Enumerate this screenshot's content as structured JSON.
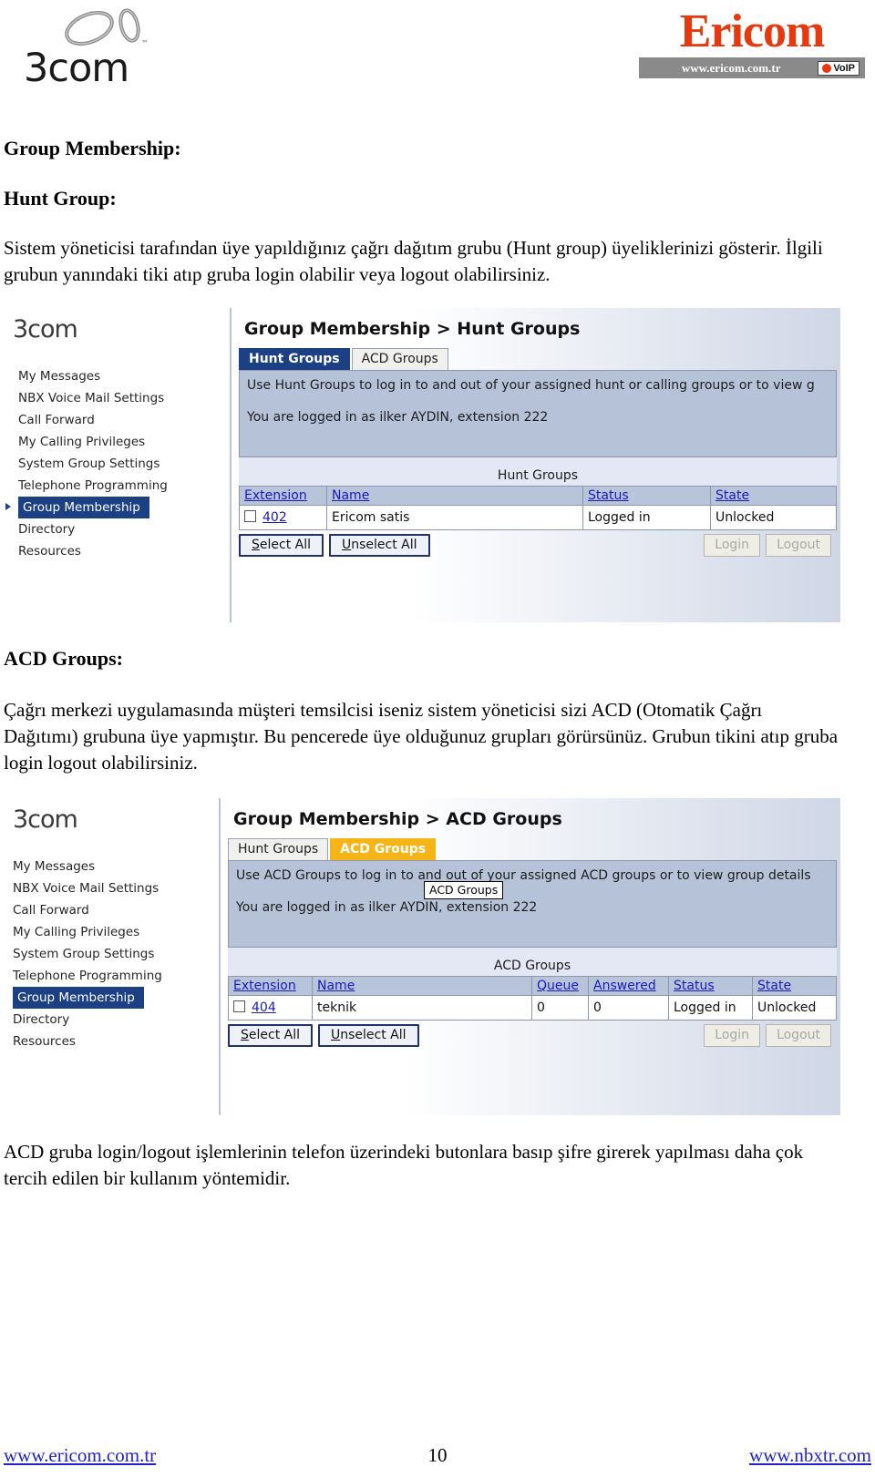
{
  "header": {
    "left_logo": "3com",
    "left_logo_tm": "™",
    "brand": {
      "name": "Ericom",
      "url": "www.ericom.com.tr",
      "badge": "VoIP"
    }
  },
  "document": {
    "heading_1": "Group Membership:",
    "heading_2": "Hunt Group:",
    "paragraph_1": "Sistem yöneticisi tarafından üye yapıldığınız çağrı dağıtım grubu (Hunt group) üyeliklerinizi gösterir. İlgili grubun yanındaki tiki atıp gruba login olabilir veya logout olabilirsiniz.",
    "heading_3": "ACD Groups:",
    "paragraph_2": "Çağrı merkezi uygulamasında müşteri temsilcisi iseniz sistem yöneticisi sizi ACD (Otomatik Çağrı Dağıtımı) grubuna üye yapmıştır. Bu pencerede üye olduğunuz grupları görürsünüz. Grubun tikini atıp gruba login logout olabilirsiniz.",
    "paragraph_3": "ACD gruba login/logout işlemlerinin telefon üzerindeki butonlara basıp şifre girerek yapılması daha çok tercih edilen bir kullanım yöntemidir."
  },
  "sidebar": {
    "logo": "3com",
    "items": [
      {
        "label": "My Messages",
        "active": false
      },
      {
        "label": "NBX Voice Mail Settings",
        "active": false
      },
      {
        "label": "Call Forward",
        "active": false
      },
      {
        "label": "My Calling Privileges",
        "active": false
      },
      {
        "label": "System Group Settings",
        "active": false
      },
      {
        "label": "Telephone Programming",
        "active": false
      },
      {
        "label": "Group Membership",
        "active": true
      },
      {
        "label": "Directory",
        "active": false
      },
      {
        "label": "Resources",
        "active": false
      }
    ]
  },
  "screenshot_hunt": {
    "title": "Group Membership > Hunt Groups",
    "tabs": [
      {
        "label": "Hunt Groups",
        "state": "active-blue"
      },
      {
        "label": "ACD Groups",
        "state": "inactive"
      }
    ],
    "info_line_1": "Use Hunt Groups to log in to and out of your assigned hunt or calling groups or to view g",
    "info_line_2": "You are logged in as ilker AYDIN, extension 222",
    "table_caption": "Hunt Groups",
    "columns": [
      "Extension",
      "Name",
      "Status",
      "State"
    ],
    "rows": [
      {
        "extension": "402",
        "name": "Ericom satis",
        "status": "Logged in",
        "state": "Unlocked"
      }
    ],
    "buttons": {
      "select_all": "Select All",
      "select_all_accel": "S",
      "unselect_all": "Unselect All",
      "unselect_all_accel": "U",
      "login": "Login",
      "logout": "Logout"
    }
  },
  "screenshot_acd": {
    "title": "Group Membership > ACD Groups",
    "tabs": [
      {
        "label": "Hunt Groups",
        "state": "inactive"
      },
      {
        "label": "ACD Groups",
        "state": "active-gold"
      }
    ],
    "tooltip": "ACD Groups",
    "info_line_1": "Use ACD Groups to log in to and out of your assigned ACD groups or to view group details",
    "info_line_2": "You are logged in as ilker AYDIN, extension 222",
    "table_caption": "ACD Groups",
    "columns": [
      "Extension",
      "Name",
      "Queue",
      "Answered",
      "Status",
      "State"
    ],
    "rows": [
      {
        "extension": "404",
        "name": "teknik",
        "queue": "0",
        "answered": "0",
        "status": "Logged in",
        "state": "Unlocked"
      }
    ],
    "buttons": {
      "select_all": "Select All",
      "select_all_accel": "S",
      "unselect_all": "Unselect All",
      "unselect_all_accel": "U",
      "login": "Login",
      "logout": "Logout"
    }
  },
  "footer": {
    "left_link": "www.ericom.com.tr",
    "page_number": "10",
    "right_link": "www.nbxtr.com"
  },
  "colors": {
    "brand_red": "#e8380d",
    "nav_active_blue": "#1b4083",
    "tab_gold": "#f5b517",
    "link_blue": "#1a1aba",
    "panel_blue": "#b6c2d8"
  }
}
